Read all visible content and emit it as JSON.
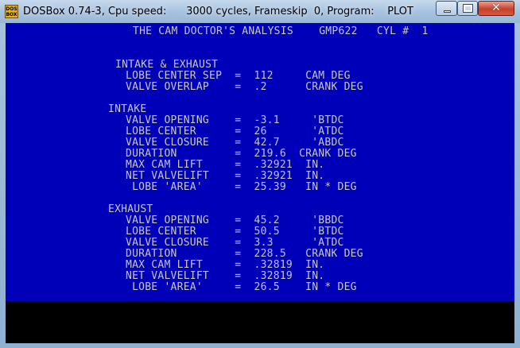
{
  "window": {
    "title": "DOSBox 0.74-3, Cpu speed:      3000 cycles, Frameskip  0, Program:    PLOT",
    "icon_label": "DOS BOX",
    "close_symbol": "✕"
  },
  "screen": {
    "header": "THE CAM DOCTOR'S ANALYSIS    GMP622   CYL #  1",
    "intake_exhaust_title": "INTAKE & EXHAUST",
    "lobe_center_sep": "LOBE CENTER SEP  =  112     CAM DEG",
    "valve_overlap": "VALVE OVERLAP    =  .2      CRANK DEG",
    "intake_title": "INTAKE",
    "intake_rows": [
      "VALVE OPENING    =  -3.1     'BTDC",
      "LOBE CENTER      =  26       'ATDC",
      "VALVE CLOSURE    =  42.7     'ABDC",
      "DURATION         =  219.6  CRANK DEG",
      "MAX CAM LIFT     =  .32921  IN.",
      "NET VALVELIFT    =  .32921  IN.",
      " LOBE 'AREA'     =  25.39   IN * DEG"
    ],
    "exhaust_title": "EXHAUST",
    "exhaust_rows": [
      "VALVE OPENING    =  45.2     'BBDC",
      "LOBE CENTER      =  50.5     'BTDC",
      "VALVE CLOSURE    =  3.3      'ATDC",
      "DURATION         =  228.5   CRANK DEG",
      "MAX CAM LIFT     =  .32819  IN.",
      "NET VALVELIFT    =  .32819  IN.",
      " LOBE 'AREA'     =  26.5    IN * DEG"
    ]
  }
}
